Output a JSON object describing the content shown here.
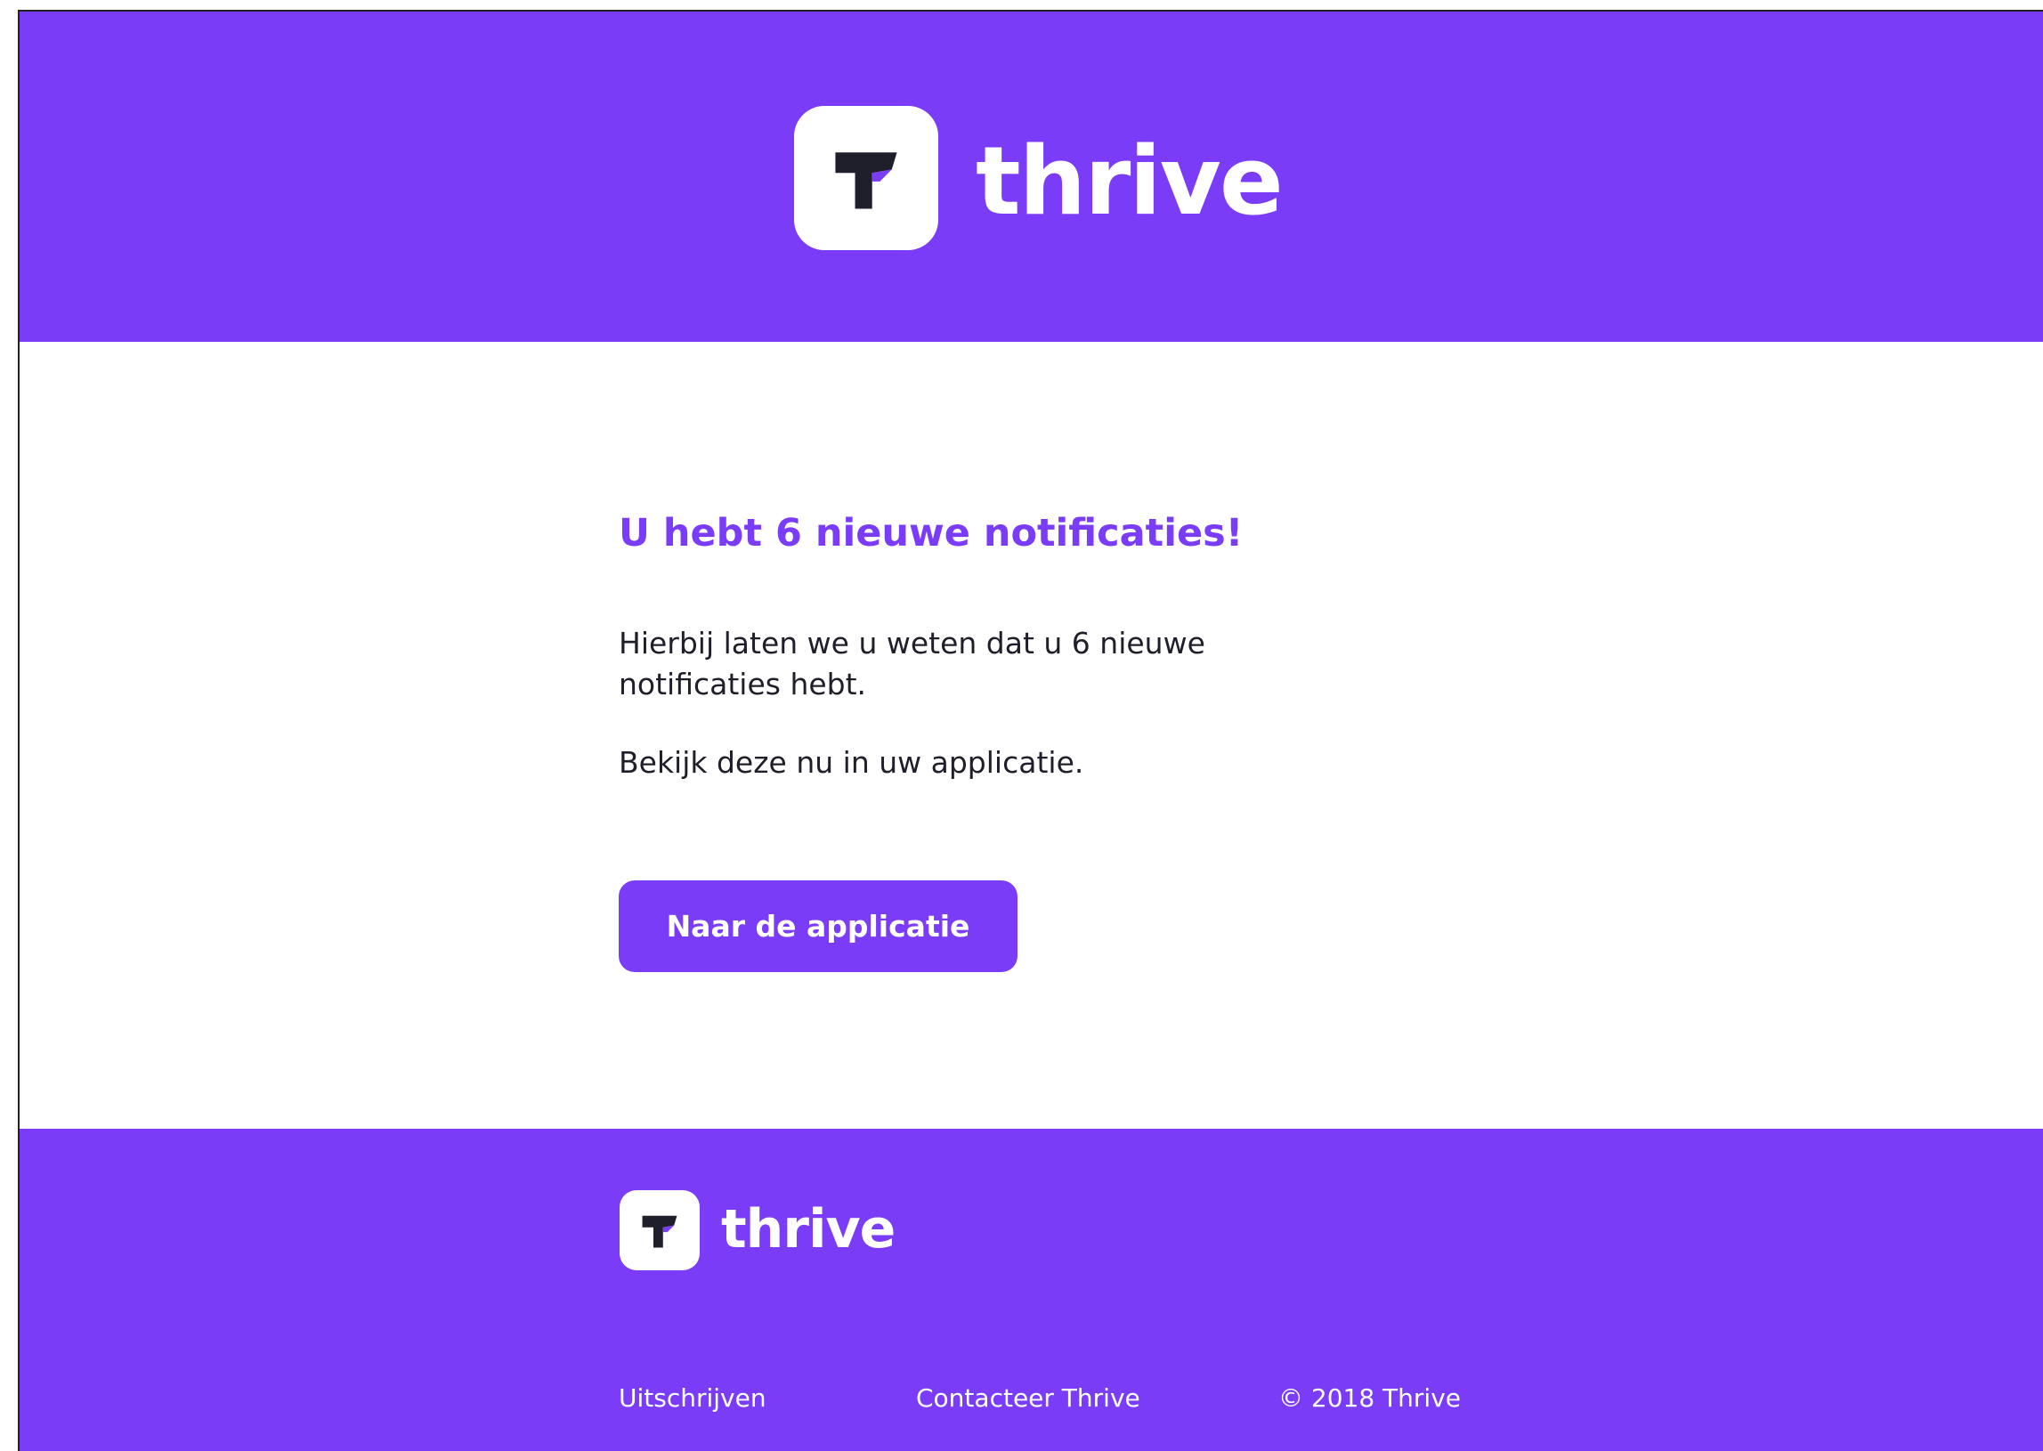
{
  "brand": {
    "name": "thrive",
    "color": "#7a3cf7",
    "mark_color": "#1f1f2b"
  },
  "header": {
    "logo_icon": "thrive-t-logo-icon",
    "wordmark": "thrive"
  },
  "email": {
    "title": "U hebt 6 nieuwe notificaties!",
    "body_1": "Hierbij laten we u weten dat u 6 nieuwe notificaties hebt.",
    "body_2": "Bekijk deze nu in uw applicatie.",
    "cta_label": "Naar de applicatie"
  },
  "footer": {
    "logo_icon": "thrive-t-logo-icon",
    "wordmark": "thrive",
    "links": {
      "unsubscribe": "Uitschrijven",
      "contact": "Contacteer Thrive",
      "copyright": "© 2018 Thrive"
    }
  }
}
